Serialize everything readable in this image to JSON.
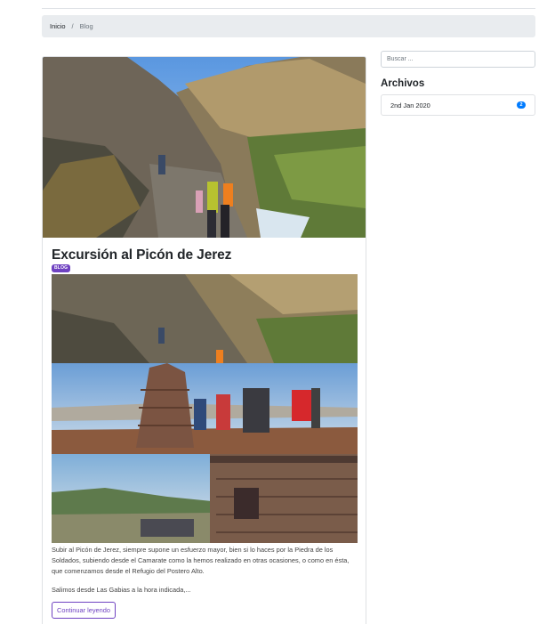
{
  "breadcrumb": {
    "home": "Inicio",
    "separator": "/",
    "current": "Blog"
  },
  "post": {
    "title": "Excursión al Picón de Jerez",
    "badge": "BLOG",
    "excerpt": "Subir al Picón de Jerez, siempre supone un esfuerzo mayor, bien si lo haces por la Piedra de los Soldados, subiendo desde el Camarate como la hemos realizado en otras ocasiones, o como en ésta, que comenzamos desde el Refugio del Postero Alto.",
    "excerpt2": "Salimos desde Las Gabias a la hora indicada,...",
    "read_more": "Continuar leyendo"
  },
  "sidebar": {
    "search_placeholder": "Buscar ...",
    "archives_title": "Archivos",
    "archives": [
      {
        "label": "2nd Jan 2020",
        "count": "2"
      }
    ]
  },
  "colors": {
    "accent": "#6f42c1",
    "primary": "#007bff",
    "breadcrumb_bg": "#e9ecef"
  }
}
